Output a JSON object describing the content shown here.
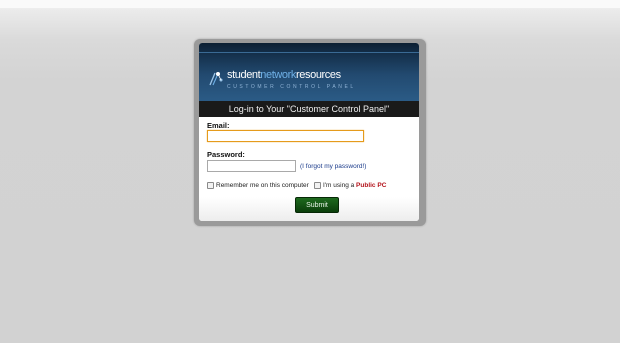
{
  "brand": {
    "logo_part1": "student",
    "logo_part2": "network",
    "logo_part3": "resources",
    "subtitle": "CUSTOMER CONTROL PANEL",
    "colors": {
      "banner": "#224a70",
      "logo_accent": "#6fb0e6"
    }
  },
  "login": {
    "heading": "Log-in to Your \"Customer Control Panel\"",
    "email_label": "Email:",
    "email_value": "",
    "password_label": "Password:",
    "password_value": "",
    "forgot_link": "(I forgot my password!)",
    "remember_label": "Remember me on this computer",
    "public_pc_prefix": "I'm using a ",
    "public_pc_highlight": "Public PC",
    "submit_label": "Submit",
    "colors": {
      "submit": "#0b3e0b",
      "focus_border": "#e59b1c",
      "highlight": "#b3121a"
    }
  }
}
